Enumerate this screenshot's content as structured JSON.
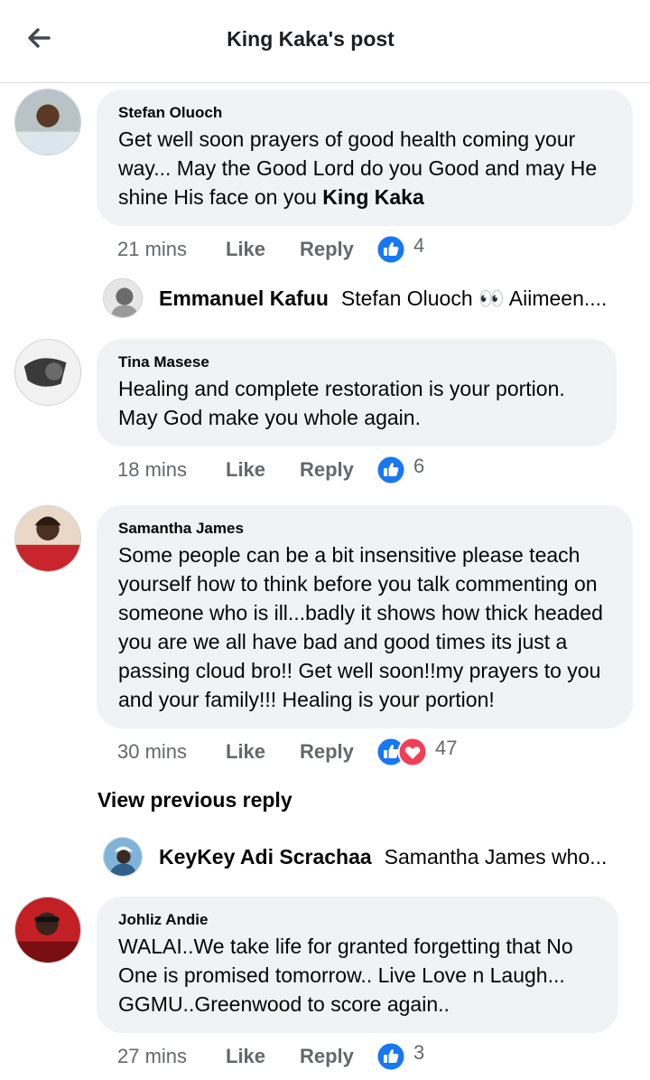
{
  "header": {
    "title": "King Kaka's post",
    "back_icon": "arrow-left-icon"
  },
  "comments": [
    {
      "author": "Stefan Oluoch",
      "text": "Get well soon prayers of good health coming your way... May the Good Lord do you Good and may He shine His face on you ",
      "mention": "King Kaka",
      "time": "21 mins",
      "like_label": "Like",
      "reply_label": "Reply",
      "reactions": [
        "like-reaction-icon"
      ],
      "reaction_count": "4"
    },
    {
      "author": "Tina Masese",
      "text": "Healing and complete restoration is your portion. May God make you whole again.",
      "time": "18 mins",
      "like_label": "Like",
      "reply_label": "Reply",
      "reactions": [
        "like-reaction-icon"
      ],
      "reaction_count": "6"
    },
    {
      "author": "Samantha James",
      "text": "Some people can be a bit insensitive please teach yourself how to think before you talk commenting on someone who is ill...badly it shows how thick headed you are we all have bad and good times its just a passing cloud bro!! Get well soon!!my prayers to you and your family!!! Healing is your portion!",
      "time": "30 mins",
      "like_label": "Like",
      "reply_label": "Reply",
      "reactions": [
        "like-reaction-icon",
        "love-reaction-icon"
      ],
      "reaction_count": "47"
    },
    {
      "author": "Johliz Andie",
      "text": "WALAI..We take life for granted forgetting that No One is promised tomorrow.. Live Love n Laugh... GGMU..Greenwood to score again..",
      "time": "27 mins",
      "like_label": "Like",
      "reply_label": "Reply",
      "reactions": [
        "like-reaction-icon"
      ],
      "reaction_count": "3"
    }
  ],
  "replies": [
    {
      "author": "Emmanuel Kafuu",
      "preview": "Stefan Oluoch 👀 Aiimeen...."
    },
    {
      "author": "KeyKey Adi Scrachaa",
      "preview": "Samantha James who..."
    }
  ],
  "view_previous_reply": "View previous reply",
  "colors": {
    "like_blue": "#1877f2",
    "love_red": "#f33e58",
    "bubble": "#f0f2f5",
    "meta_gray": "#65676b"
  }
}
